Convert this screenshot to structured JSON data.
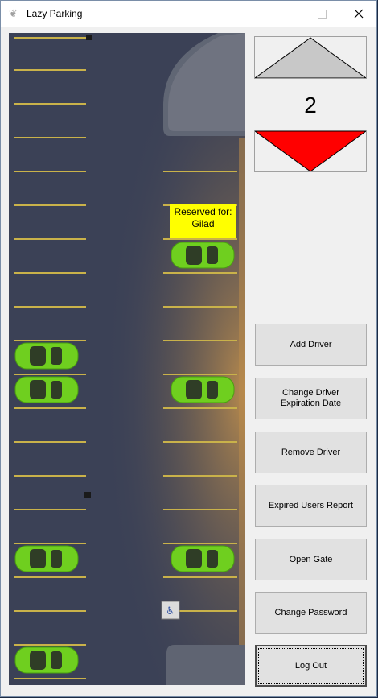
{
  "window": {
    "title": "Lazy Parking",
    "icon": "app-icon",
    "controls": [
      "minimize-icon",
      "maximize-icon",
      "close-icon"
    ]
  },
  "parking_lot": {
    "reserved_label": "Reserved for:",
    "reserved_name": "Gilad",
    "car_color": "#6fcf1f",
    "reserved_color": "#ffff00",
    "accessible_sign": "wheelchair-icon",
    "occupied_spots": 7
  },
  "floor": {
    "number": "2",
    "up_button_color": "#c8c8c8",
    "down_button_color": "#ff0000"
  },
  "actions": {
    "add_driver": "Add Driver",
    "change_expiration": "Change Driver Expiration Date",
    "remove_driver": "Remove Driver",
    "expired_report": "Expired Users Report",
    "open_gate": "Open Gate",
    "change_password": "Change Password",
    "log_out": "Log Out"
  }
}
